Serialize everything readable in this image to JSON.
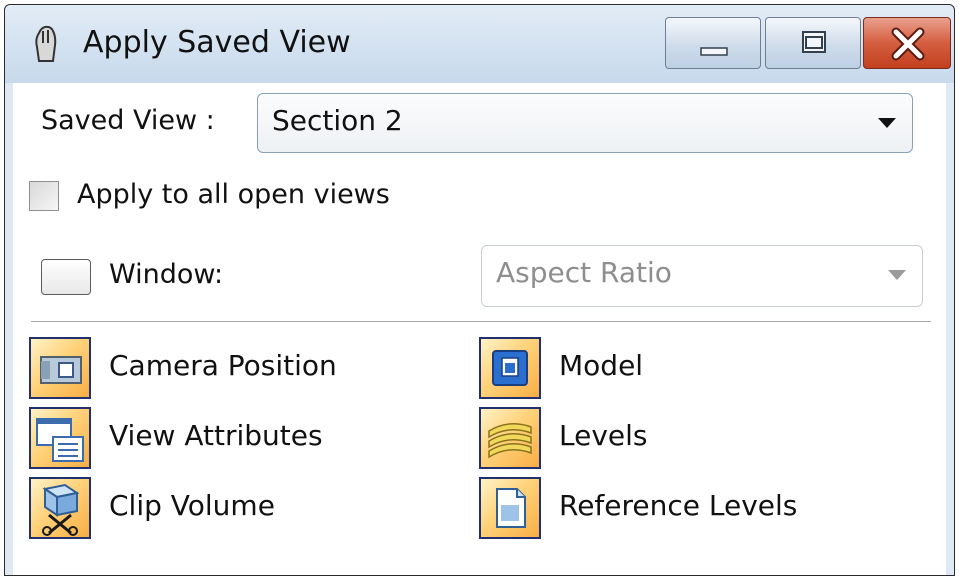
{
  "window": {
    "title": "Apply Saved View",
    "icon": "hand-icon"
  },
  "title_buttons": {
    "minimize": "minimize-icon",
    "maximize": "maximize-icon",
    "close": "close-icon"
  },
  "saved_view": {
    "label": "Saved View :",
    "value": "Section 2"
  },
  "apply_all": {
    "label": "Apply to all open views",
    "checked": false
  },
  "window_option": {
    "label": "Window:",
    "enabled": false,
    "select_value": "Aspect Ratio"
  },
  "options": {
    "camera_position": {
      "label": "Camera Position",
      "icon": "camera-icon"
    },
    "view_attributes": {
      "label": "View Attributes",
      "icon": "view-attributes-icon"
    },
    "clip_volume": {
      "label": "Clip Volume",
      "icon": "clip-volume-icon"
    },
    "model": {
      "label": "Model",
      "icon": "model-icon"
    },
    "levels": {
      "label": "Levels",
      "icon": "levels-icon"
    },
    "reference_levels": {
      "label": "Reference Levels",
      "icon": "reference-levels-icon"
    }
  },
  "colors": {
    "toggle_border": "#23306e",
    "toggle_fill": "#ffd27a",
    "close_button": "#d45e40",
    "titlebar": "#c7d9ec"
  }
}
